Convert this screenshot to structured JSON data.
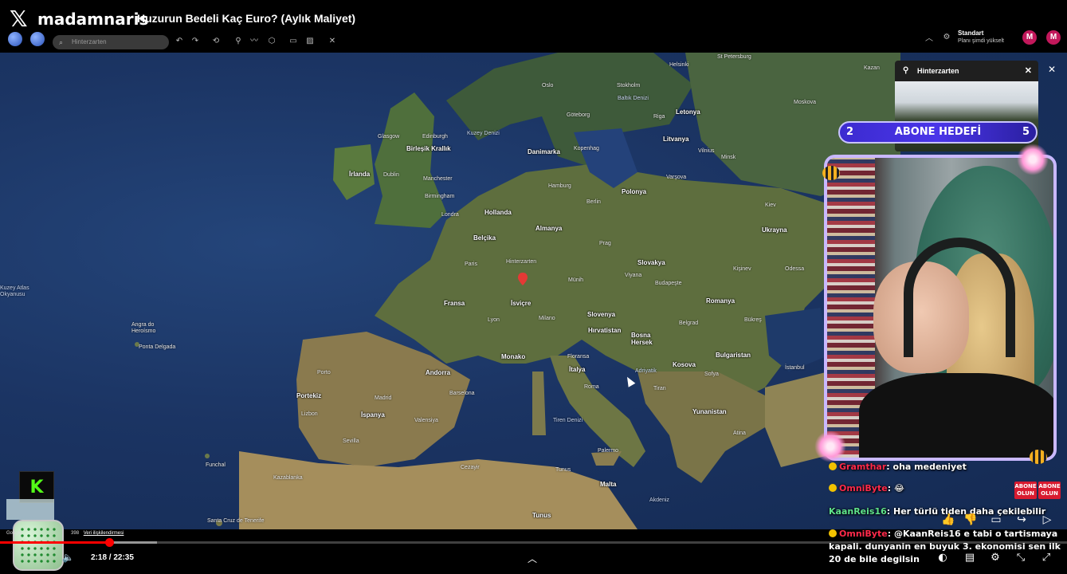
{
  "header": {
    "channel": "madamnaris",
    "video_title": "Huzurun Bedeli Kaç Euro? (Aylık Maliyet)"
  },
  "earth_toolbar": {
    "search_placeholder": "Hinterzarten"
  },
  "account": {
    "plan": "Standart",
    "plan_sub": "Planı şimdi yükselt",
    "avatar_letter": "M"
  },
  "info_card": {
    "place": "Hinterzarten"
  },
  "sub_goal": {
    "current": "2",
    "label": "ABONE HEDEFİ",
    "target": "5",
    "accent": "#4a35e8"
  },
  "map": {
    "countries": [
      "Birleşik Krallık",
      "İrlanda",
      "Danimarka",
      "Letonya",
      "Litvanya",
      "Hollanda",
      "Belçika",
      "Almanya",
      "Polonya",
      "Ukrayna",
      "Fransa",
      "İsviçre",
      "Slovakya",
      "Romanya",
      "Slovenya",
      "Hırvatistan",
      "Bosna Hersek",
      "Bulgaristan",
      "Kosova",
      "İtalya",
      "Monako",
      "Portekiz",
      "İspanya",
      "Andorra",
      "Yunanistan",
      "Malta",
      "Tunus"
    ],
    "cities": [
      "Glasgow",
      "Edinburgh",
      "Dublin",
      "Manchester",
      "Birmingham",
      "Londra",
      "Paris",
      "Hinterzarten",
      "Hamburg",
      "Berlin",
      "Kopenhag",
      "Göteborg",
      "Stokholm",
      "Oslo",
      "Riga",
      "Vilnius",
      "Minsk",
      "Varşova",
      "Prag",
      "Viyana",
      "Budapeşte",
      "Münih",
      "Lyon",
      "Milano",
      "Floransa",
      "Roma",
      "Belgrad",
      "Bükreş",
      "Kiev",
      "Kişinev",
      "Odessa",
      "Sofya",
      "İstanbul",
      "Tiran",
      "Atina",
      "Barselona",
      "Valensiya",
      "Madrid",
      "Porto",
      "Lizbon",
      "Sevilla",
      "Kazablanka",
      "Palermo",
      "Cezayir",
      "Tunus",
      "St Petersburg",
      "Moskova",
      "Helsinki",
      "Kazan",
      "Ponta Delgada",
      "Funchal",
      "Angra do Heroísmo",
      "Santa Cruz de Tenerife"
    ],
    "ocean": "Kuzey Atlas Okyanusu",
    "sea_north": "Kuzey Denizi",
    "sea_baltic": "Baltık Denizi",
    "sea_tyrrhenian": "Tiren Denizi",
    "sea_adriatic": "Adriyatik",
    "sea_mediterranean": "Akdeniz",
    "sea_label_west": "Kuzey Atlas Okyanusu",
    "marker_place": "Hinterzarten"
  },
  "chat": {
    "messages": [
      {
        "user": "Gramthar",
        "text": "oha medeniyet"
      },
      {
        "user": "OmniByte",
        "text": "😂"
      },
      {
        "user": "KaanReis16",
        "text": "Her türlü tiden daha çekilebilir"
      },
      {
        "user": "OmniByte",
        "text": "@KaanReis16 e tabi o tartismaya kapali. dunyanin en buyuk 3. ekonomisi sen ilk 20 de bile degilsin"
      }
    ]
  },
  "overlay": {
    "abone_1": "ABONE OLUN",
    "abone_2": "ABONE OLUN",
    "streamer_logo": "K"
  },
  "footer": {
    "attribution": "Google",
    "attribution_partial": "398",
    "attribution_link": "Veri ilişkilendirmesi"
  },
  "player": {
    "current_time": "2:18",
    "duration": "22:35",
    "time_display": "2:18 / 22:35",
    "progress_fraction": 0.102,
    "buffer_fraction": 0.147
  }
}
